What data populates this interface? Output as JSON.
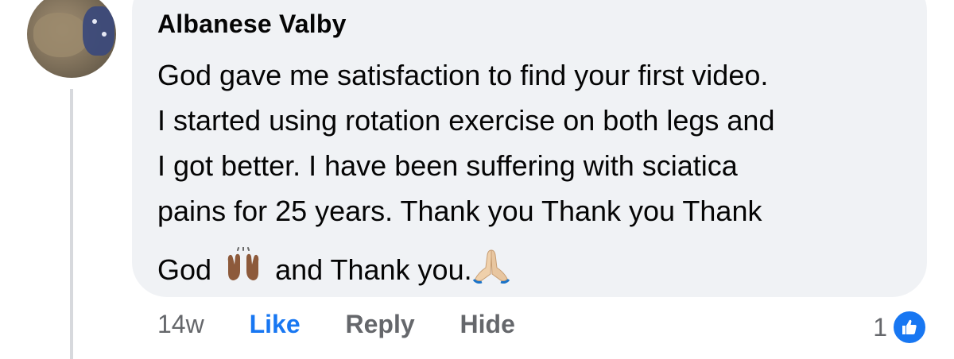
{
  "comment": {
    "author": "Albanese Valby",
    "lines": [
      "God gave me satisfaction to find your first video.",
      "I started using rotation exercise on both legs and",
      "I got better.  I have been suffering with sciatica",
      "pains for 25 years.  Thank you Thank you Thank"
    ],
    "last_line": {
      "part1": "God",
      "emoji1": "raising-hands-icon",
      "part2": "and Thank you.",
      "emoji2": "folded-hands-icon"
    },
    "timestamp": "14w",
    "actions": {
      "like": "Like",
      "reply": "Reply",
      "hide": "Hide"
    },
    "reactions": {
      "count": "1",
      "icon": "thumbs-up-icon"
    }
  },
  "colors": {
    "bubble": "#f0f2f5",
    "text": "#050505",
    "secondary_text": "#65676b",
    "accent": "#1877f2"
  }
}
